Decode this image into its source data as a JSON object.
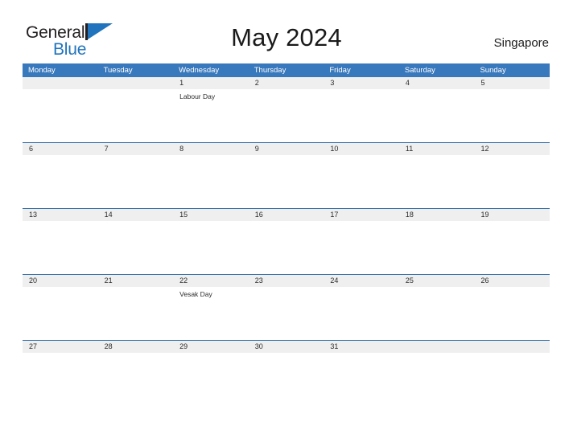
{
  "brand": {
    "name_top": "General",
    "name_bottom": "Blue",
    "flag_icon": "blue-flag-triangle",
    "accent_color": "#1f74bd"
  },
  "header": {
    "title": "May 2024",
    "region": "Singapore"
  },
  "colors": {
    "header_blue": "#3878bc",
    "row_separator_blue": "#2e6da8",
    "date_band_gray": "#efefef",
    "text_dark": "#1a1a1a",
    "text_white": "#ffffff"
  },
  "calendar": {
    "weekdays": [
      "Monday",
      "Tuesday",
      "Wednesday",
      "Thursday",
      "Friday",
      "Saturday",
      "Sunday"
    ],
    "weeks": [
      {
        "days": [
          {
            "date": "",
            "events": []
          },
          {
            "date": "",
            "events": []
          },
          {
            "date": "1",
            "events": [
              "Labour Day"
            ]
          },
          {
            "date": "2",
            "events": []
          },
          {
            "date": "3",
            "events": []
          },
          {
            "date": "4",
            "events": []
          },
          {
            "date": "5",
            "events": []
          }
        ]
      },
      {
        "days": [
          {
            "date": "6",
            "events": []
          },
          {
            "date": "7",
            "events": []
          },
          {
            "date": "8",
            "events": []
          },
          {
            "date": "9",
            "events": []
          },
          {
            "date": "10",
            "events": []
          },
          {
            "date": "11",
            "events": []
          },
          {
            "date": "12",
            "events": []
          }
        ]
      },
      {
        "days": [
          {
            "date": "13",
            "events": []
          },
          {
            "date": "14",
            "events": []
          },
          {
            "date": "15",
            "events": []
          },
          {
            "date": "16",
            "events": []
          },
          {
            "date": "17",
            "events": []
          },
          {
            "date": "18",
            "events": []
          },
          {
            "date": "19",
            "events": []
          }
        ]
      },
      {
        "days": [
          {
            "date": "20",
            "events": []
          },
          {
            "date": "21",
            "events": []
          },
          {
            "date": "22",
            "events": [
              "Vesak Day"
            ]
          },
          {
            "date": "23",
            "events": []
          },
          {
            "date": "24",
            "events": []
          },
          {
            "date": "25",
            "events": []
          },
          {
            "date": "26",
            "events": []
          }
        ]
      },
      {
        "days": [
          {
            "date": "27",
            "events": []
          },
          {
            "date": "28",
            "events": []
          },
          {
            "date": "29",
            "events": []
          },
          {
            "date": "30",
            "events": []
          },
          {
            "date": "31",
            "events": []
          },
          {
            "date": "",
            "events": []
          },
          {
            "date": "",
            "events": []
          }
        ]
      }
    ]
  }
}
